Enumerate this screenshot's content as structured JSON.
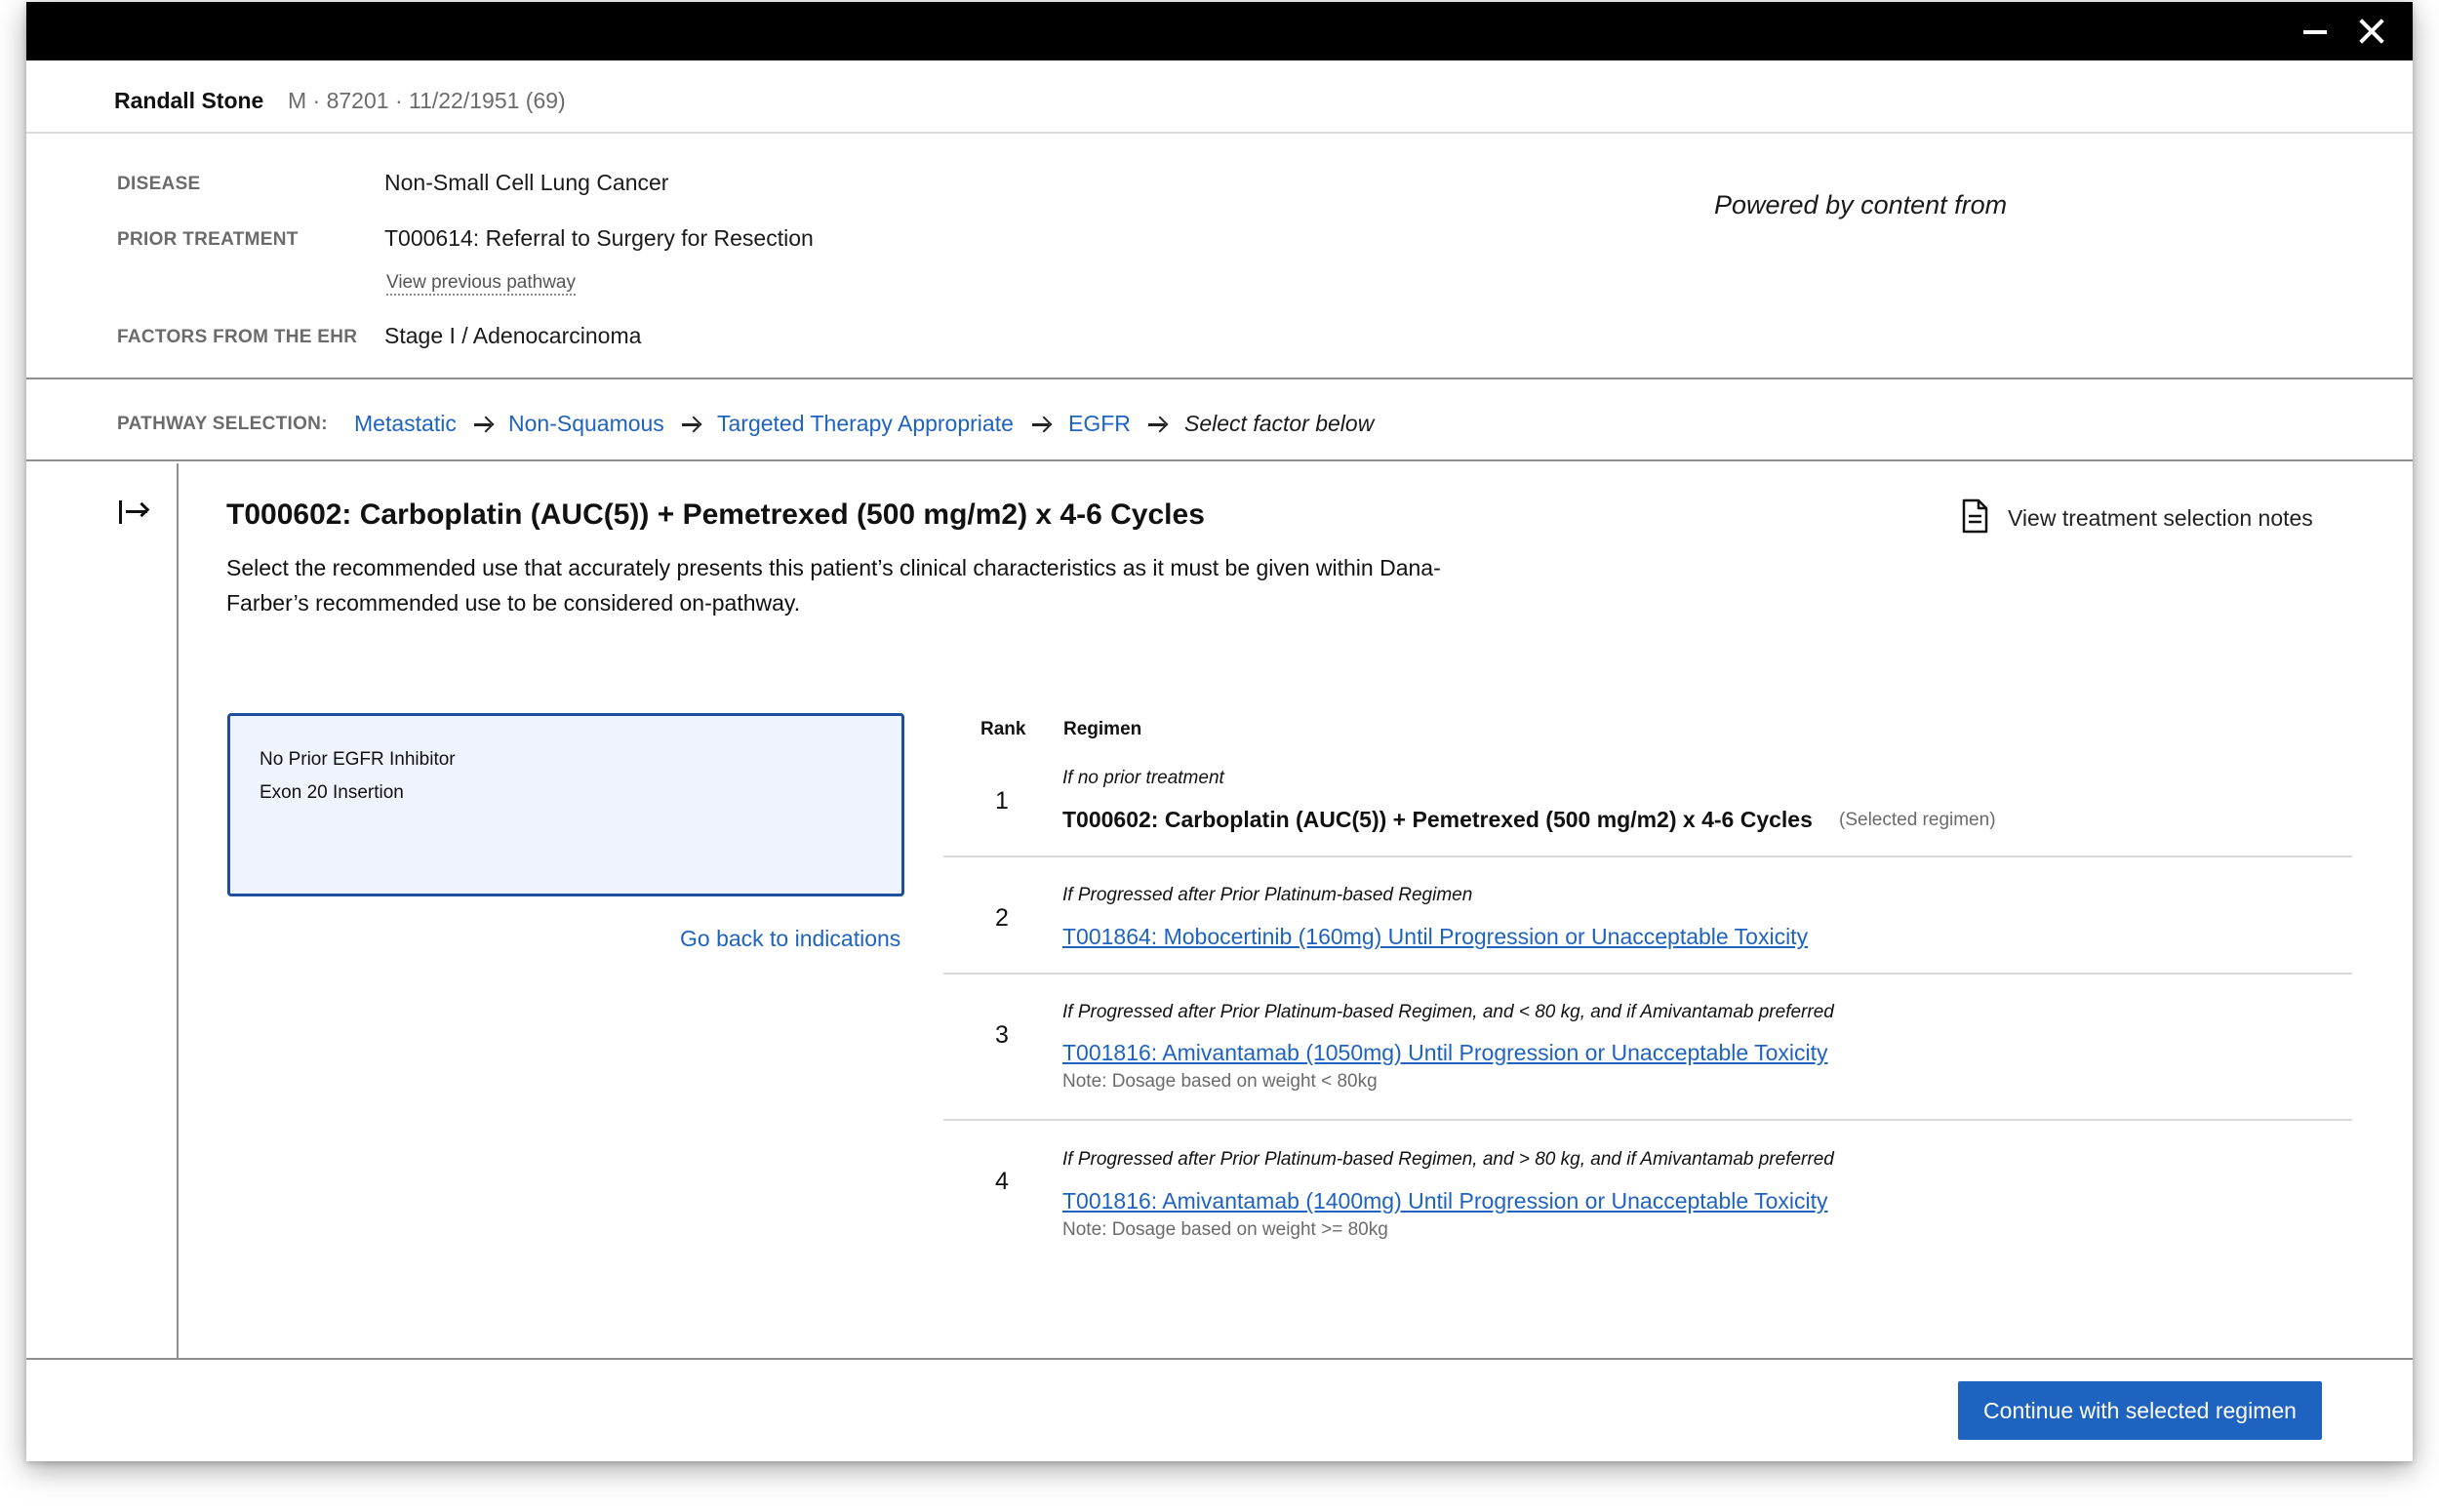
{
  "patient": {
    "name": "Randall Stone",
    "meta": "M · 87201 · 11/22/1951 (69)"
  },
  "info": {
    "disease_label": "DISEASE",
    "disease_value": "Non-Small Cell Lung Cancer",
    "prior_label": "PRIOR TREATMENT",
    "prior_value": "T000614: Referral to Surgery for Resection",
    "view_previous": "View previous pathway",
    "factors_label": "FACTORS FROM THE EHR",
    "factors_value": "Stage I / Adenocarcinoma",
    "powered_by": "Powered by content from"
  },
  "pathway": {
    "label": "PATHWAY SELECTION:",
    "steps": [
      "Metastatic",
      "Non-Squamous",
      "Targeted Therapy Appropriate",
      "EGFR"
    ],
    "current": "Select factor below"
  },
  "regimen": {
    "title": "T000602: Carboplatin (AUC(5)) + Pemetrexed (500 mg/m2) x 4-6 Cycles",
    "description": "Select the recommended use that accurately presents this patient’s clinical characteristics as it must be given within Dana-Farber’s recommended use to be considered on-pathway.",
    "notes_label": "View treatment selection notes"
  },
  "factor_box": {
    "lines": [
      "No Prior EGFR Inhibitor",
      "Exon 20 Insertion"
    ]
  },
  "go_back": "Go back to indications",
  "table": {
    "headers": {
      "rank": "Rank",
      "regimen": "Regimen"
    },
    "rows": [
      {
        "rank": "1",
        "condition": "If no prior treatment",
        "regimen": "T000602: Carboplatin (AUC(5)) + Pemetrexed (500 mg/m2) x 4-6 Cycles",
        "selected_note": "(Selected regimen)"
      },
      {
        "rank": "2",
        "condition": "If Progressed after Prior Platinum-based Regimen",
        "regimen": "T001864: Mobocertinib (160mg) Until Progression or Unacceptable Toxicity"
      },
      {
        "rank": "3",
        "condition": "If Progressed after Prior Platinum-based Regimen, and < 80 kg, and if Amivantamab preferred",
        "regimen": "T001816: Amivantamab (1050mg) Until Progression or Unacceptable Toxicity",
        "note": "Note: Dosage based on weight < 80kg"
      },
      {
        "rank": "4",
        "condition": "If Progressed after Prior Platinum-based Regimen, and > 80 kg, and if Amivantamab preferred",
        "regimen": "T001816: Amivantamab (1400mg) Until Progression or Unacceptable Toxicity",
        "note": "Note: Dosage based on weight >= 80kg"
      }
    ]
  },
  "footer": {
    "continue_label": "Continue with selected regimen"
  },
  "icons": {
    "window_controls": [
      "minimize-icon",
      "close-icon"
    ],
    "rail": "expand-panel-icon",
    "notes": "document-icon",
    "pathway_separator": "arrow-right-icon"
  },
  "colors": {
    "link": "#1f63c0",
    "primary_button": "#1f63c0",
    "factor_border": "#1f4f9c",
    "factor_bg": "#eef3fd",
    "titlebar": "#000000"
  }
}
